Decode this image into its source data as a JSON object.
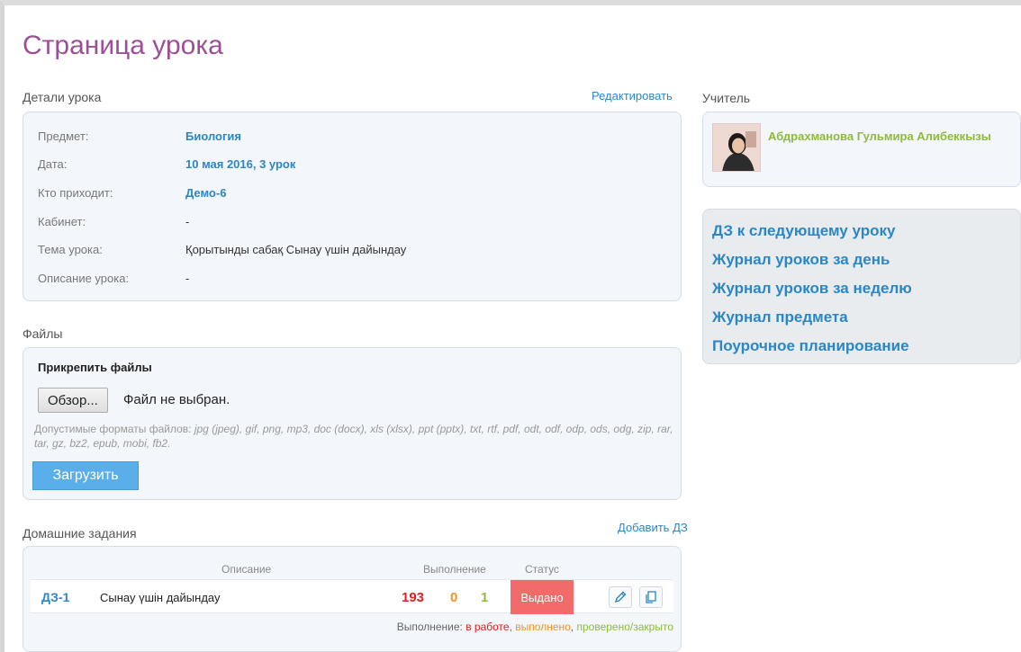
{
  "page": {
    "title": "Страница урока"
  },
  "details": {
    "heading": "Детали урока",
    "edit_label": "Редактировать",
    "rows": [
      {
        "label": "Предмет:",
        "value": "Биология"
      },
      {
        "label": "Дата:",
        "value": "10 мая 2016, 3 урок"
      },
      {
        "label": "Кто приходит:",
        "value": "Демо-6"
      },
      {
        "label": "Кабинет:",
        "value": "-"
      },
      {
        "label": "Тема урока:",
        "value": "Қорытынды сабақ Сынау үшін дайындау"
      },
      {
        "label": "Описание урока:",
        "value": "-"
      }
    ]
  },
  "files": {
    "heading": "Файлы",
    "attach_title": "Прикрепить файлы",
    "browse_label": "Обзор...",
    "no_file_label": "Файл не выбран.",
    "formats_prefix": "Допустимые форматы файлов:",
    "formats_list": "jpg (jpeg), gif, png, mp3, doc (docx), xls (xlsx), ppt (pptx), txt, rtf, pdf, odt, odf, odp, ods, odg, zip, rar, tar, gz, bz2, epub, mobi, fb2.",
    "upload_label": "Загрузить"
  },
  "homework": {
    "heading": "Домашние задания",
    "add_label": "Добавить ДЗ",
    "columns": {
      "description": "Описание",
      "completion": "Выполнение",
      "status": "Статус"
    },
    "rows": [
      {
        "id": "ДЗ-1",
        "description": "Сынау үшін дайындау",
        "in_progress": "193",
        "done": "0",
        "checked": "1",
        "status": "Выдано"
      }
    ],
    "legend": {
      "prefix": "Выполнение:",
      "in_progress": "в работе",
      "done": "выполнено",
      "checked": "проверено/закрыто",
      "sep": ","
    }
  },
  "teacher": {
    "heading": "Учитель",
    "name": "Абдрахманова Гульмира Алибеккызы"
  },
  "nav_links": [
    "ДЗ к следующему уроку",
    "Журнал уроков за день",
    "Журнал уроков за неделю",
    "Журнал предмета",
    "Поурочное планирование"
  ],
  "colors": {
    "title": "#9b4f96",
    "link": "#2c86c4",
    "in_progress": "#e02020",
    "done": "#f0932b",
    "checked": "#8fba3a",
    "status_badge": "#f16b6b",
    "upload_button": "#5aaee9",
    "teacher_name": "#8fba3a"
  },
  "icons": {
    "edit": "pencil-icon",
    "copy": "copy-icon"
  }
}
